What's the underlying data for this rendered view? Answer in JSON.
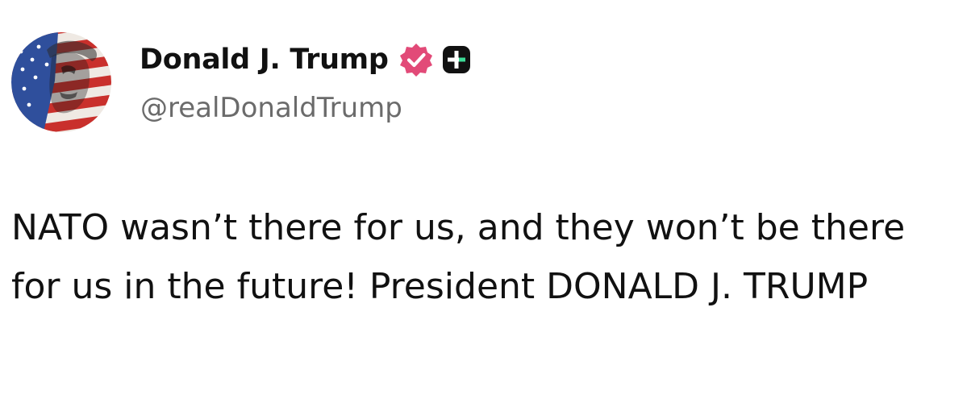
{
  "author": {
    "display_name": "Donald J. Trump",
    "handle": "@realDonaldTrump",
    "avatar_icon": "avatar-flag-portrait",
    "verified_icon": "verified-badge-icon",
    "verified_color": "#e24a78",
    "plus_badge_icon": "plus-badge-icon",
    "plus_badge_color": "#111111"
  },
  "post": {
    "text": "NATO wasn’t there for us, and they won’t be there for us in the future! President DONALD J. TRUMP"
  }
}
